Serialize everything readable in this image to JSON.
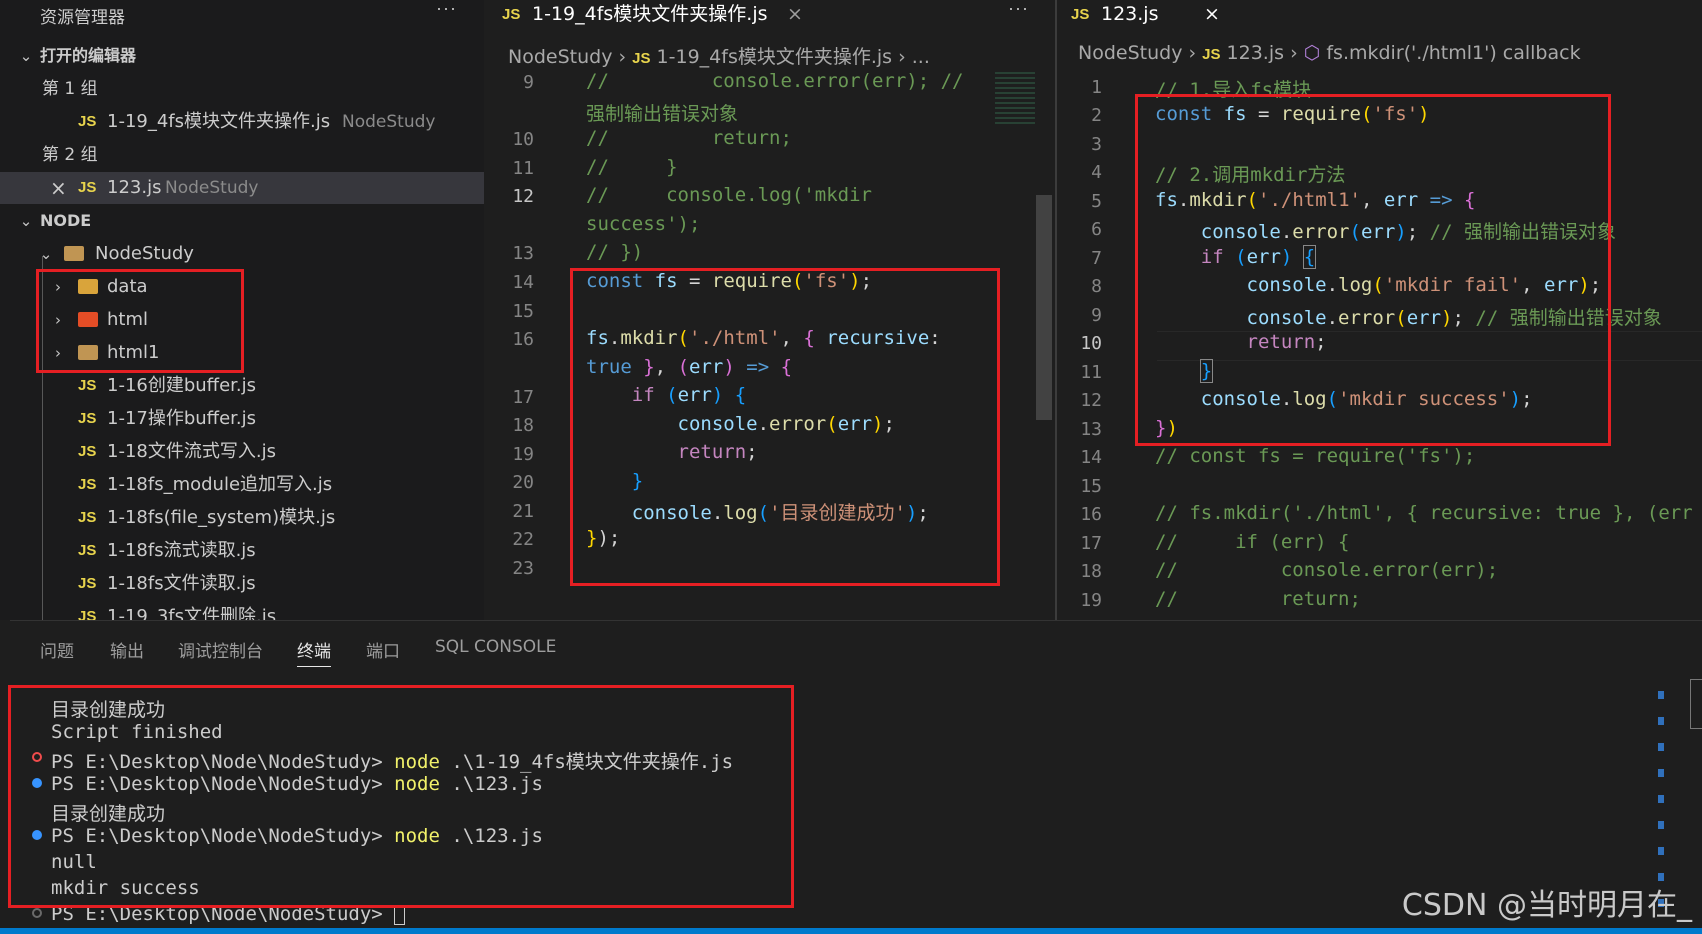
{
  "explorer": {
    "title": "资源管理器",
    "more": "···",
    "open_editors": "打开的编辑器",
    "group1": "第 1 组",
    "group1_file": "1-19_4fs模块文件夹操作.js",
    "group1_desc": "NodeStudy",
    "group2": "第 2 组",
    "group2_file": "123.js",
    "group2_desc": "NodeStudy",
    "section": "NODE",
    "project": "NodeStudy",
    "folders": [
      "data",
      "html",
      "html1"
    ],
    "files": [
      "1-16创建buffer.js",
      "1-17操作buffer.js",
      "1-18文件流式写入.js",
      "1-18fs_module追加写入.js",
      "1-18fs(file_system)模块.js",
      "1-18fs流式读取.js",
      "1-18fs文件读取.js",
      "1-19_3fs文件删除.js"
    ],
    "js": "JS",
    "close": "×"
  },
  "editor1": {
    "tab": "1-19_4fs模块文件夹操作.js",
    "bc_root": "NodeStudy",
    "bc_file": "1-19_4fs模块文件夹操作.js",
    "bc_more": "...",
    "lines": [
      "9",
      "10",
      "11",
      "12",
      "13",
      "14",
      "15",
      "16",
      "17",
      "18",
      "19",
      "20",
      "21",
      "22",
      "23"
    ]
  },
  "editor2": {
    "tab": "123.js",
    "bc_root": "NodeStudy",
    "bc_file": "123.js",
    "bc_symbol": "fs.mkdir('./html1') callback",
    "lines": [
      "1",
      "2",
      "3",
      "4",
      "5",
      "6",
      "7",
      "8",
      "9",
      "10",
      "11",
      "12",
      "13",
      "14",
      "15",
      "16",
      "17",
      "18",
      "19"
    ]
  },
  "panel": {
    "tabs": [
      "问题",
      "输出",
      "调试控制台",
      "终端",
      "端口",
      "SQL CONSOLE"
    ],
    "term": {
      "l1": "目录创建成功",
      "l2": "Script finished",
      "l3_prompt": "PS E:\\Desktop\\Node\\NodeStudy> ",
      "l3_cmd": "node",
      "l3_arg": " .\\1-19_4fs模块文件夹操作.js",
      "l4_prompt": "PS E:\\Desktop\\Node\\NodeStudy> ",
      "l4_cmd": "node",
      "l4_arg": " .\\123.js",
      "l5": "目录创建成功",
      "l6_prompt": "PS E:\\Desktop\\Node\\NodeStudy> ",
      "l6_cmd": "node",
      "l6_arg": " .\\123.js",
      "l7": "null",
      "l8": "mkdir success",
      "l9_prompt": "PS E:\\Desktop\\Node\\NodeStudy> "
    }
  },
  "watermark": "CSDN @当时明月在_"
}
